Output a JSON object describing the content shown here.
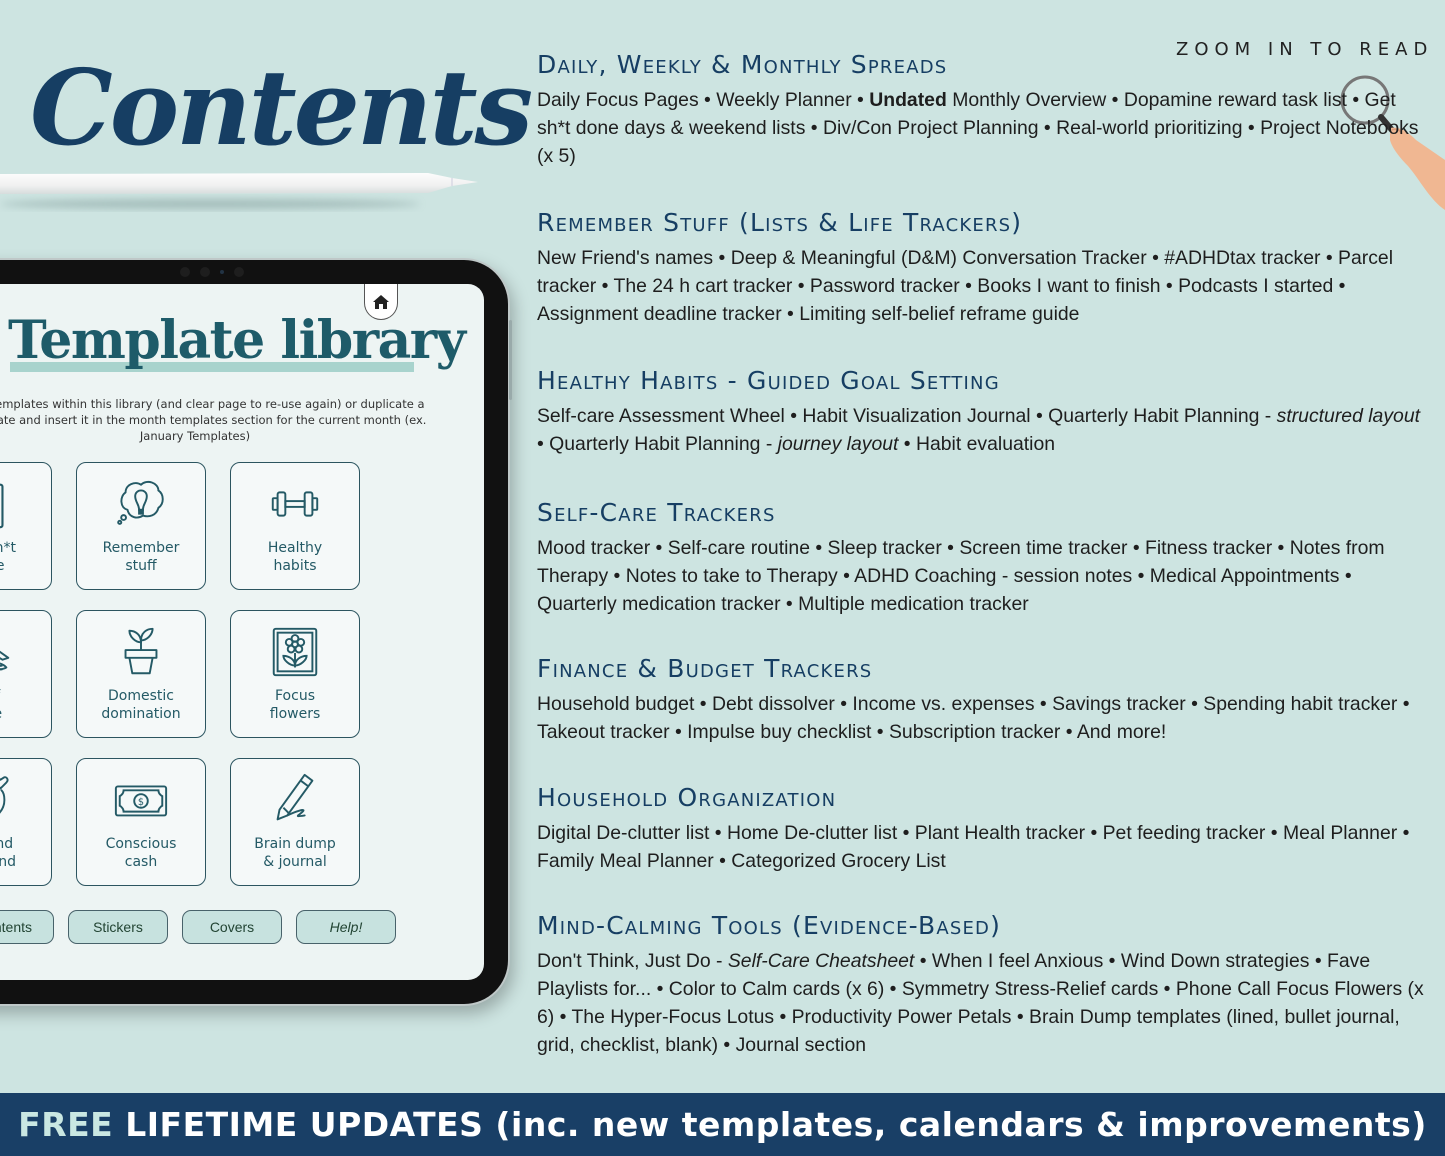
{
  "header": {
    "title": "Contents",
    "zoom_hint": "ZOOM IN TO READ"
  },
  "tablet": {
    "title": "Template library",
    "description": "Use templates within this library (and clear page to re-use again) or duplicate a template and insert it in the month templates section for the current month (ex. January Templates)",
    "tiles": [
      {
        "label": "Get sh*t\ndone",
        "icon": "clipboard-check-icon"
      },
      {
        "label": "Remember\nstuff",
        "icon": "lightbulb-thought-icon"
      },
      {
        "label": "Healthy\nhabits",
        "icon": "dumbbell-icon"
      },
      {
        "label": "Self\ncare",
        "icon": "meditation-icon"
      },
      {
        "label": "Domestic\ndomination",
        "icon": "plant-pot-icon"
      },
      {
        "label": "Focus\nflowers",
        "icon": "framed-flower-icon"
      },
      {
        "label": "Unwind\nun-mind",
        "icon": "calm-face-heart-icon"
      },
      {
        "label": "Conscious\ncash",
        "icon": "banknote-icon"
      },
      {
        "label": "Brain dump\n& journal",
        "icon": "pencil-scribble-icon"
      }
    ],
    "buttons": [
      "Contents",
      "Stickers",
      "Covers",
      "Help!"
    ]
  },
  "sections": [
    {
      "title": "Daily, Weekly & Monthly Spreads",
      "body_parts": [
        {
          "t": "Daily Focus Pages • Weekly Planner • "
        },
        {
          "t": "Undated",
          "style": "bold"
        },
        {
          "t": " Monthly Overview • Dopamine reward task list • Get sh*t done days & weekend lists • Div/Con Project Planning • Real-world prioritizing • Project Notebooks (x 5)"
        }
      ]
    },
    {
      "title": "Remember Stuff (Lists & Life Trackers)",
      "body_parts": [
        {
          "t": "New Friend's names • Deep & Meaningful (D&M) Conversation Tracker • #ADHDtax tracker • Parcel tracker • The  24 h cart tracker • Password tracker • Books I want to finish • Podcasts I started • Assignment deadline tracker • Limiting self-belief reframe guide"
        }
      ]
    },
    {
      "title": "Healthy Habits - Guided Goal Setting",
      "body_parts": [
        {
          "t": "Self-care Assessment Wheel • Habit Visualization Journal • Quarterly Habit Planning - "
        },
        {
          "t": "structured layout",
          "style": "italic"
        },
        {
          "t": " • Quarterly Habit Planning - "
        },
        {
          "t": "journey layout",
          "style": "italic"
        },
        {
          "t": " • Habit evaluation"
        }
      ]
    },
    {
      "title": "Self-Care Trackers",
      "body_parts": [
        {
          "t": "Mood tracker • Self-care routine • Sleep tracker • Screen time tracker • Fitness tracker • Notes from Therapy • Notes to take to Therapy •  ADHD Coaching - session notes • Medical Appointments • Quarterly medication tracker • Multiple medication tracker"
        }
      ]
    },
    {
      "title": "Finance & Budget Trackers",
      "body_parts": [
        {
          "t": "Household budget • Debt dissolver • Income vs. expenses • Savings tracker • Spending habit tracker • Takeout tracker • Impulse buy checklist • Subscription tracker • And more!"
        }
      ]
    },
    {
      "title": "Household Organization",
      "body_parts": [
        {
          "t": "Digital De-clutter list • Home De-clutter list • Plant Health tracker •  Pet feeding tracker • Meal Planner • Family Meal Planner • Categorized Grocery List"
        }
      ]
    },
    {
      "title": "Mind-Calming Tools (Evidence-Based)",
      "body_parts": [
        {
          "t": "Don't Think, Just Do - "
        },
        {
          "t": "Self-Care Cheatsheet",
          "style": "italic"
        },
        {
          "t": " • When I feel Anxious • Wind Down strategies • Fave Playlists for... • Color to Calm cards (x 6) • Symmetry Stress-Relief cards • Phone Call Focus Flowers (x 6) • The Hyper-Focus Lotus • Productivity Power Petals • Brain Dump templates (lined, bullet journal, grid, checklist, blank) • Journal section"
        }
      ]
    }
  ],
  "banner": {
    "free": "FREE",
    "rest": "LIFETIME UPDATES (inc. new templates, calendars & improvements)"
  },
  "colors": {
    "background": "#cde4e1",
    "navy": "#163e63",
    "teal": "#1e5b69",
    "banner": "#193f66",
    "free_highlight": "#c9e7e2",
    "pill": "#c7e2df"
  }
}
